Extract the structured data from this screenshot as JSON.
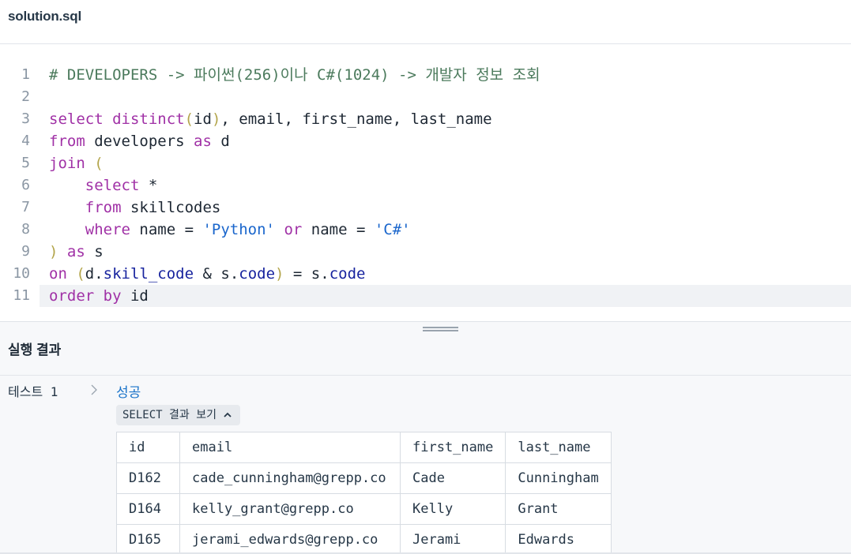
{
  "file": {
    "name": "solution.sql"
  },
  "editor": {
    "lines": [
      {
        "n": "1",
        "tokens": [
          {
            "c": "t-com",
            "t": "# DEVELOPERS -> 파이썬(256)이나 C#(1024) -> 개발자 정보 조회"
          }
        ]
      },
      {
        "n": "2",
        "tokens": []
      },
      {
        "n": "3",
        "tokens": [
          {
            "c": "t-kw",
            "t": "select "
          },
          {
            "c": "t-fn",
            "t": "distinct"
          },
          {
            "c": "t-paren",
            "t": "("
          },
          {
            "c": "t-id",
            "t": "id"
          },
          {
            "c": "t-paren",
            "t": ")"
          },
          {
            "c": "t-punc",
            "t": ", email, first_name, last_name"
          }
        ]
      },
      {
        "n": "4",
        "tokens": [
          {
            "c": "t-kw",
            "t": "from "
          },
          {
            "c": "t-id",
            "t": "developers "
          },
          {
            "c": "t-kw",
            "t": "as "
          },
          {
            "c": "t-id",
            "t": "d"
          }
        ]
      },
      {
        "n": "5",
        "tokens": [
          {
            "c": "t-kw",
            "t": "join "
          },
          {
            "c": "t-paren",
            "t": "("
          }
        ]
      },
      {
        "n": "6",
        "tokens": [
          {
            "c": "t-id",
            "t": "    "
          },
          {
            "c": "t-kw",
            "t": "select "
          },
          {
            "c": "t-punc",
            "t": "*"
          }
        ]
      },
      {
        "n": "7",
        "tokens": [
          {
            "c": "t-id",
            "t": "    "
          },
          {
            "c": "t-kw",
            "t": "from "
          },
          {
            "c": "t-id",
            "t": "skillcodes"
          }
        ]
      },
      {
        "n": "8",
        "tokens": [
          {
            "c": "t-id",
            "t": "    "
          },
          {
            "c": "t-kw",
            "t": "where "
          },
          {
            "c": "t-id",
            "t": "name = "
          },
          {
            "c": "t-str",
            "t": "'Python'"
          },
          {
            "c": "t-kw",
            "t": " or "
          },
          {
            "c": "t-id",
            "t": "name = "
          },
          {
            "c": "t-str",
            "t": "'C#'"
          }
        ]
      },
      {
        "n": "9",
        "tokens": [
          {
            "c": "t-paren",
            "t": ")"
          },
          {
            "c": "t-kw",
            "t": " as "
          },
          {
            "c": "t-id",
            "t": "s"
          }
        ]
      },
      {
        "n": "10",
        "tokens": [
          {
            "c": "t-kw",
            "t": "on "
          },
          {
            "c": "t-paren",
            "t": "("
          },
          {
            "c": "t-id",
            "t": "d."
          },
          {
            "c": "t-prop",
            "t": "skill_code"
          },
          {
            "c": "t-id",
            "t": " & s."
          },
          {
            "c": "t-prop",
            "t": "code"
          },
          {
            "c": "t-paren",
            "t": ")"
          },
          {
            "c": "t-id",
            "t": " = s."
          },
          {
            "c": "t-prop",
            "t": "code"
          }
        ]
      },
      {
        "n": "11",
        "tokens": [
          {
            "c": "t-kw",
            "t": "order by "
          },
          {
            "c": "t-id",
            "t": "id"
          }
        ]
      }
    ],
    "active_line": "11"
  },
  "results": {
    "title": "실행 결과",
    "test_label": "테스트 1",
    "status": "성공",
    "toggle_label": "SELECT 결과 보기",
    "table": {
      "columns": [
        "id",
        "email",
        "first_name",
        "last_name"
      ],
      "rows": [
        [
          "D162",
          "cade_cunningham@grepp.co",
          "Cade",
          "Cunningham"
        ],
        [
          "D164",
          "kelly_grant@grepp.co",
          "Kelly",
          "Grant"
        ],
        [
          "D165",
          "jerami_edwards@grepp.co",
          "Jerami",
          "Edwards"
        ]
      ]
    }
  },
  "colors": {
    "success": "#1a73c9",
    "keyword": "#a031a6",
    "string": "#1a66cc",
    "comment": "#4b7a5c"
  }
}
